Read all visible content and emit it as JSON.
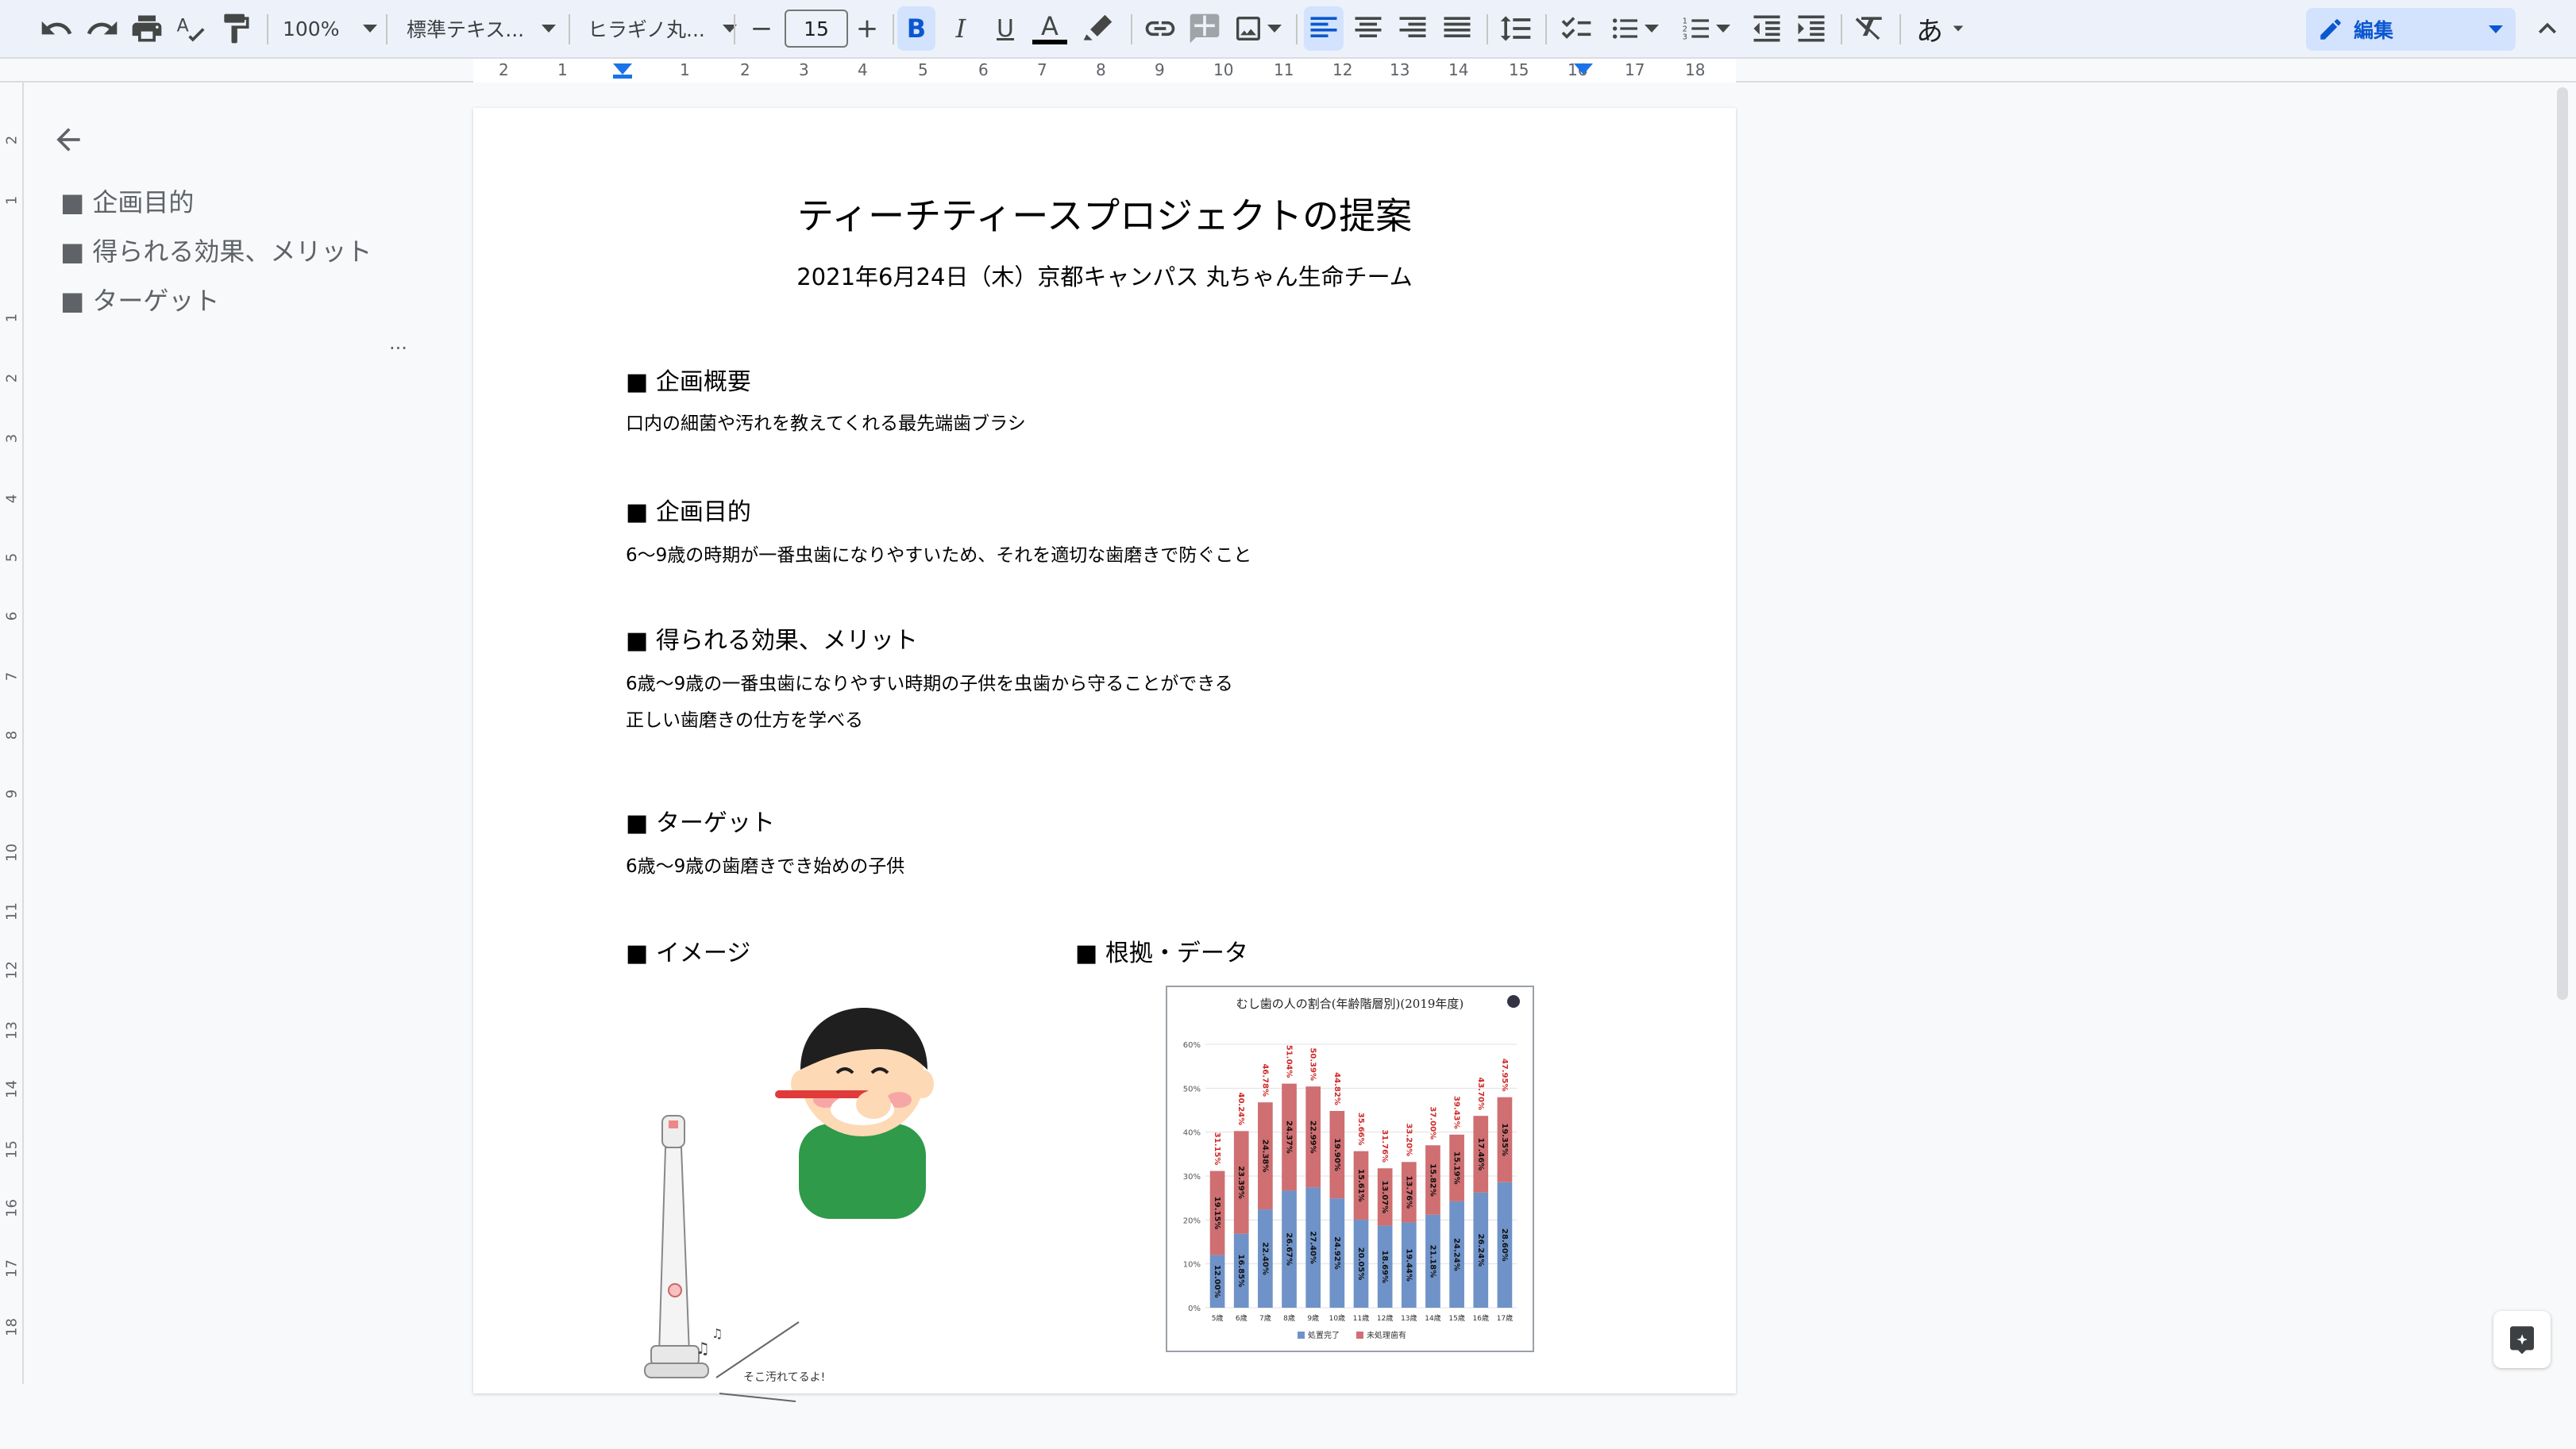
{
  "toolbar": {
    "zoom": "100%",
    "style": "標準テキス...",
    "font": "ヒラギノ丸...",
    "font_size": "15",
    "minus": "−",
    "plus": "+",
    "bold": "B",
    "italic": "I",
    "underline": "U",
    "textcolor": "A",
    "input_tools": "あ",
    "mode": "編集"
  },
  "ruler": {
    "h": [
      "2",
      "1",
      "1",
      "2",
      "3",
      "4",
      "5",
      "6",
      "7",
      "8",
      "9",
      "10",
      "11",
      "12",
      "13",
      "14",
      "15",
      "16",
      "17",
      "18"
    ],
    "v": [
      "2",
      "1",
      "1",
      "2",
      "3",
      "4",
      "5",
      "6",
      "7",
      "8",
      "9",
      "10",
      "11",
      "12",
      "13",
      "14",
      "15",
      "16",
      "17",
      "18"
    ]
  },
  "outline": {
    "items": [
      "■ 企画目的",
      "■ 得られる効果、メリット",
      "■ ターゲット"
    ],
    "more": "..."
  },
  "doc": {
    "title": "ティーチティースプロジェクトの提案",
    "subtitle": "2021年6月24日（木）京都キャンパス 丸ちゃん生命チーム",
    "sec1_h": "■ 企画概要",
    "sec1_p": "口内の細菌や汚れを教えてくれる最先端歯ブラシ",
    "sec2_h": "■ 企画目的",
    "sec2_p": "6〜9歳の時期が一番虫歯になりやすいため、それを適切な歯磨きで防ぐこと",
    "sec3_h": "■ 得られる効果、メリット",
    "sec3_p1": "6歳〜9歳の一番虫歯になりやすい時期の子供を虫歯から守ることができる",
    "sec3_p2": "正しい歯磨きの仕方を学べる",
    "sec4_h": "■ ターゲット",
    "sec4_p": "6歳〜9歳の歯磨きでき始めの子供",
    "img_h": "■ イメージ",
    "data_h": "■ 根拠・データ",
    "speech": "そこ汚れてるよ!",
    "note": "♫"
  },
  "chart_data": {
    "type": "bar",
    "title": "むし歯の人の割合(年齢階層別)(2019年度)",
    "categories": [
      "5歳",
      "6歳",
      "7歳",
      "8歳",
      "9歳",
      "10歳",
      "11歳",
      "12歳",
      "13歳",
      "14歳",
      "15歳",
      "16歳",
      "17歳"
    ],
    "series": [
      {
        "name": "処置完了",
        "values": [
          12.0,
          16.85,
          22.4,
          26.67,
          27.4,
          24.92,
          20.05,
          18.69,
          19.44,
          21.18,
          24.24,
          26.24,
          28.6
        ]
      },
      {
        "name": "未処理歯有",
        "values": [
          19.15,
          23.39,
          24.38,
          24.37,
          22.99,
          19.9,
          15.61,
          13.07,
          13.76,
          15.82,
          15.19,
          17.46,
          19.35
        ]
      }
    ],
    "totals": [
      "31.15%",
      "40.24%",
      "46.78%",
      "51.04%",
      "50.39%",
      "44.82%",
      "35.66%",
      "31.76%",
      "33.20%",
      "37.00%",
      "39.43%",
      "43.70%",
      "47.95%"
    ],
    "yticks": [
      "0%",
      "10%",
      "20%",
      "30%",
      "40%",
      "50%",
      "60%"
    ],
    "ylim": [
      0,
      60
    ],
    "colors": {
      "done": "#6f93c8",
      "untreated": "#cf6f72"
    }
  }
}
